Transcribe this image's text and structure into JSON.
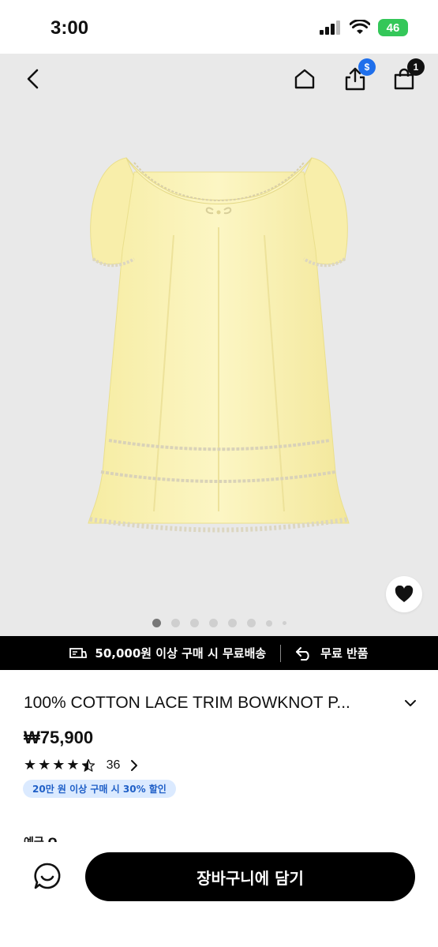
{
  "status_bar": {
    "time": "3:00",
    "battery": "46"
  },
  "nav": {
    "share_badge": "$",
    "cart_count": "1"
  },
  "icons": {
    "back": "chevron-left-icon",
    "home": "home-icon",
    "share": "share-icon",
    "cart": "shopping-bag-icon",
    "wishlist": "heart-icon",
    "shipping": "truck-icon",
    "return": "return-arrow-icon",
    "chat": "chat-bubble-icon",
    "expand": "chevron-down-icon"
  },
  "gallery": {
    "total_dots": 8,
    "active_index": 0
  },
  "promo": {
    "free_shipping": "50,000원 이상 구매 시 무료배송",
    "free_return": "무료 반품"
  },
  "product": {
    "title": "100% COTTON LACE TRIM BOWKNOT P...",
    "price": "₩75,900",
    "rating_value": 4.5,
    "rating_count": "36",
    "discount_badge": "20만 원 이상 구매 시 30% 할인",
    "next_section": "예금 O"
  },
  "actions": {
    "add_to_cart": "장바구니에 담기"
  },
  "colors": {
    "accent_blue": "#1f6feb",
    "product_yellow": "#fbf3b8",
    "black": "#000000"
  }
}
